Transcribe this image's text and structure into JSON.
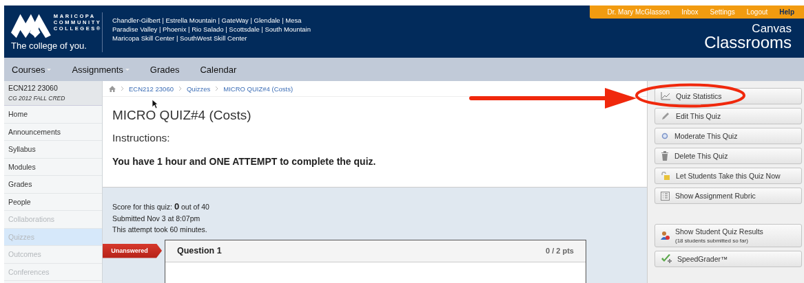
{
  "header": {
    "logo_lines": [
      "MARICOPA",
      "COMMUNITY",
      "COLLEGES®"
    ],
    "tagline": "The college of you.",
    "colleges": [
      "Chandler-Gilbert | Estrella Mountain | GateWay | Glendale | Mesa",
      "Paradise Valley | Phoenix | Rio Salado | Scottsdale | South Mountain",
      "Maricopa Skill Center | SouthWest Skill Center"
    ],
    "user_links": [
      {
        "label": "Dr. Mary McGlasson",
        "kind": "link"
      },
      {
        "label": "Inbox",
        "kind": "link"
      },
      {
        "label": "Settings",
        "kind": "link"
      },
      {
        "label": "Logout",
        "kind": "link"
      },
      {
        "label": "Help",
        "kind": "help"
      }
    ],
    "brand": [
      "Canvas",
      "Classrooms"
    ]
  },
  "nav": [
    {
      "label": "Courses",
      "has_menu": true
    },
    {
      "label": "Assignments",
      "has_menu": true
    },
    {
      "label": "Grades",
      "has_menu": false
    },
    {
      "label": "Calendar",
      "has_menu": false
    }
  ],
  "sidebar": {
    "course": "ECN212 23060",
    "term": "CG 2012 FALL CRED",
    "items": [
      {
        "label": "Home",
        "disabled": false,
        "selected": false
      },
      {
        "label": "Announcements",
        "disabled": false,
        "selected": false
      },
      {
        "label": "Syllabus",
        "disabled": false,
        "selected": false
      },
      {
        "label": "Modules",
        "disabled": false,
        "selected": false
      },
      {
        "label": "Grades",
        "disabled": false,
        "selected": false
      },
      {
        "label": "People",
        "disabled": false,
        "selected": false
      },
      {
        "label": "Collaborations",
        "disabled": true,
        "selected": false
      },
      {
        "label": "Quizzes",
        "disabled": true,
        "selected": true
      },
      {
        "label": "Outcomes",
        "disabled": true,
        "selected": false
      },
      {
        "label": "Conferences",
        "disabled": true,
        "selected": false
      }
    ]
  },
  "breadcrumb": [
    "ECN212 23060",
    "Quizzes",
    "MICRO QUIZ#4 (Costs)"
  ],
  "quiz": {
    "title": "MICRO QUIZ#4 (Costs)",
    "instructions_heading": "Instructions:",
    "instructions": "You have 1 hour and ONE ATTEMPT to complete the quiz.",
    "score_line": "Score for this quiz: **0** out of 40",
    "submitted": "Submitted Nov 3 at 8:07pm",
    "duration": "This attempt took 60 minutes.",
    "question": {
      "status": "Unanswered",
      "title": "Question 1",
      "points": "0 / 2 pts"
    }
  },
  "actions": [
    {
      "label": "Quiz Statistics",
      "kind": "chart",
      "highlighted": true
    },
    {
      "label": "Edit This Quiz",
      "kind": "pencil",
      "highlighted": false
    },
    {
      "label": "Moderate This Quiz",
      "kind": "circle",
      "highlighted": false
    },
    {
      "label": "Delete This Quiz",
      "kind": "trash",
      "highlighted": false
    },
    {
      "label": "Let Students Take this Quiz Now",
      "kind": "lock",
      "highlighted": false
    },
    {
      "label": "Show Assignment Rubric",
      "kind": "rubric",
      "highlighted": false
    }
  ],
  "secondary_actions": [
    {
      "label": "Show Student Quiz Results",
      "note": "(18 students submitted so far)",
      "kind": "people"
    },
    {
      "label": "SpeedGrader™",
      "kind": "check"
    }
  ]
}
